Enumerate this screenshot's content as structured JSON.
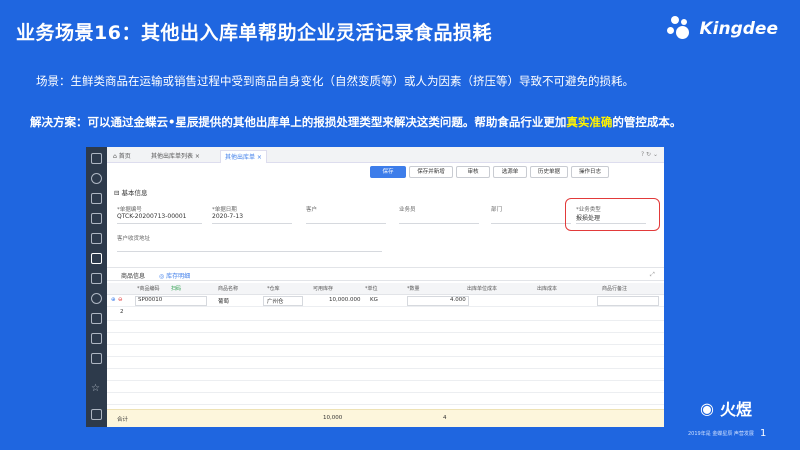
{
  "slide": {
    "title": "业务场景16：其他出入库单帮助企业灵活记录食品损耗",
    "logo_text": "Kingdee",
    "scenario": "场景：生鲜类商品在运输或销售过程中受到商品自身变化（自然变质等）或人为因素（挤压等）导致不可避免的损耗。",
    "solution_prefix": "解决方案：可以通过金蝶云•星辰提供的其他出库单上的报损处理类型来解决这类问题。帮助食品行业更加",
    "solution_highlight": "真实准确",
    "solution_suffix": "的管控成本。",
    "highlight_color": "#fff200",
    "watermark": "火煜",
    "page_number": "1",
    "footer_small": "2019年是 金蝶星辰 声营发展"
  },
  "app": {
    "tabs": [
      {
        "label": "首页"
      },
      {
        "label": "其他出库单列表"
      },
      {
        "label": "其他出库单"
      }
    ],
    "toolbar": {
      "save": "保存",
      "save_new": "保存并新增",
      "audit": "审核",
      "select_source": "选源单",
      "history": "历史单据",
      "log": "操作日志"
    },
    "basic_info": "基本信息",
    "fields": {
      "bill_no_label": "*单据编号",
      "bill_no": "QTCK-20200713-00001",
      "date_label": "*单据日期",
      "date": "2020-7-13",
      "customer_label": "客户",
      "salesman_label": "业务员",
      "dept_label": "部门",
      "biz_type_label": "*业务类型",
      "biz_type": "报损处理",
      "address_label": "客户收货地址"
    },
    "grid": {
      "title": "商品信息",
      "stock_detail": "库存明细",
      "headers": [
        "*商品编码",
        "商品名称",
        "*仓库",
        "可用库存",
        "*单位",
        "*数量",
        "出库单位成本",
        "出库成本",
        "商品行备注"
      ],
      "scan_label": "扫码",
      "rows": [
        {
          "no": "1",
          "code": "SP00010",
          "name": "葡萄",
          "warehouse": "广州仓",
          "stock": "10,000.000",
          "unit": "KG",
          "qty": "4.000"
        },
        {
          "no": "2",
          "code": "",
          "name": "",
          "warehouse": "",
          "stock": "",
          "unit": "",
          "qty": ""
        }
      ],
      "footer_label": "合计",
      "footer_stock": "10,000",
      "footer_qty": "4"
    }
  }
}
